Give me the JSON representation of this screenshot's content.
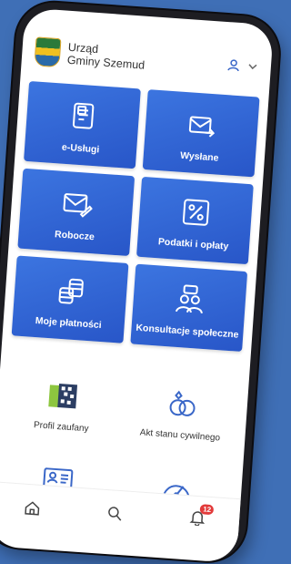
{
  "header": {
    "title_line1": "Urząd",
    "title_line2": "Gminy Szemud",
    "crest_icon": "coat-of-arms-logo",
    "user_icon": "user-icon",
    "chevron_icon": "chevron-down-icon"
  },
  "tiles": [
    {
      "label": "e-Usługi",
      "icon": "document-icon"
    },
    {
      "label": "Wysłane",
      "icon": "sent-mail-icon"
    },
    {
      "label": "Robocze",
      "icon": "draft-mail-icon"
    },
    {
      "label": "Podatki i opłaty",
      "icon": "percent-icon"
    },
    {
      "label": "Moje płatności",
      "icon": "coins-icon"
    },
    {
      "label": "Konsultacje społeczne",
      "icon": "people-chat-icon"
    }
  ],
  "plain_items": [
    {
      "label": "Profil zaufany",
      "icon": "trusted-profile-icon"
    },
    {
      "label": "Akt stanu cywilnego",
      "icon": "rings-icon"
    }
  ],
  "row3_items": [
    {
      "icon": "id-card-icon"
    },
    {
      "icon": "speedometer-icon"
    }
  ],
  "tabbar": {
    "home_icon": "home-icon",
    "search_icon": "search-icon",
    "notifications_icon": "bell-icon",
    "notifications_count": "12"
  },
  "colors": {
    "background": "#3f6fb6",
    "tile": "#3366d6",
    "accent": "#3a67c8",
    "badge": "#e23a3a"
  }
}
